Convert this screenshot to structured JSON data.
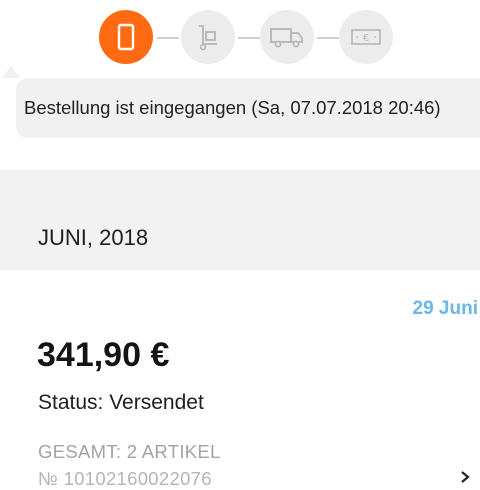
{
  "progress": {
    "steps": [
      {
        "name": "order-received",
        "icon": "phone-icon",
        "active": true
      },
      {
        "name": "packed",
        "icon": "hand-truck-icon",
        "active": false
      },
      {
        "name": "shipped",
        "icon": "truck-icon",
        "active": false
      },
      {
        "name": "paid",
        "icon": "euro-banknote-icon",
        "active": false
      }
    ],
    "tooltip": "Bestellung ist eingegangen (Sa, 07.07.2018 20:46)"
  },
  "month_header": {
    "label": "JUNI, 2018"
  },
  "order": {
    "date": "29 Juni",
    "amount": "341,90 €",
    "status": "Status: Versendet",
    "total_items": "GESAMT: 2 ARTIKEL",
    "number": "№ 10102160022076"
  },
  "colors": {
    "active_step": "#ff6a13",
    "inactive_step": "#ececec",
    "date_accent": "#6ab7e8",
    "section_bg": "#f2f2f2",
    "muted_text": "#a3a3a3"
  }
}
